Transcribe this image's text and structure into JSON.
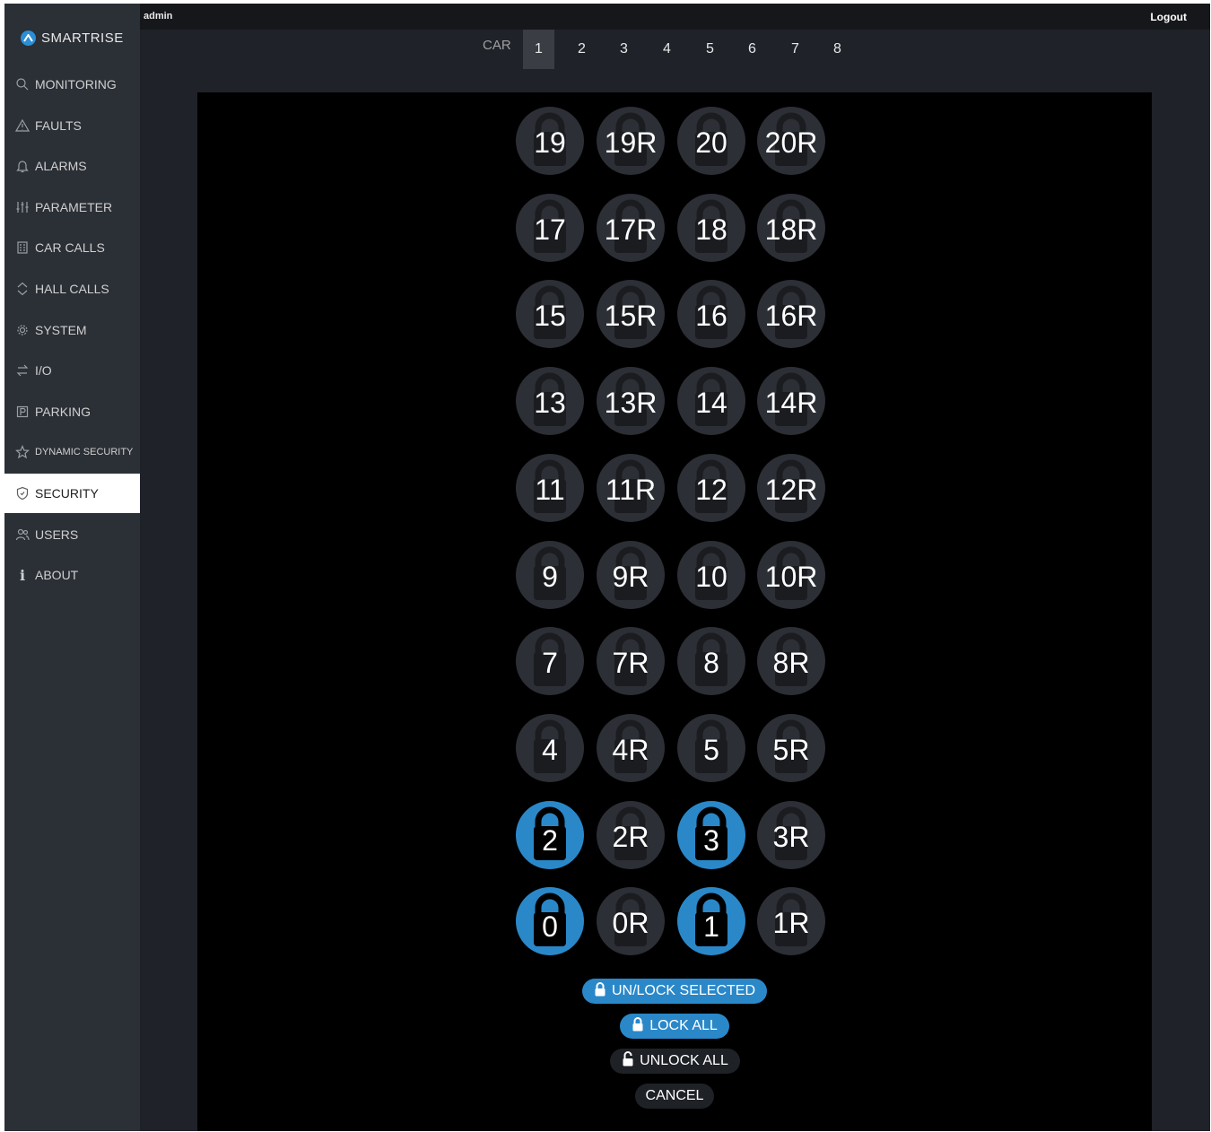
{
  "header": {
    "user": "admin",
    "logout": "Logout"
  },
  "brand": {
    "name": "SMARTRISE"
  },
  "nav": [
    {
      "label": "MONITORING",
      "icon": "search-icon"
    },
    {
      "label": "FAULTS",
      "icon": "warning-icon"
    },
    {
      "label": "ALARMS",
      "icon": "bell-icon"
    },
    {
      "label": "PARAMETER",
      "icon": "sliders-icon"
    },
    {
      "label": "CAR CALLS",
      "icon": "keypad-icon"
    },
    {
      "label": "HALL CALLS",
      "icon": "up-down-icon"
    },
    {
      "label": "SYSTEM",
      "icon": "gear-icon"
    },
    {
      "label": "I/O",
      "icon": "swap-arrows-icon"
    },
    {
      "label": "PARKING",
      "icon": "parking-icon"
    },
    {
      "label": "DYNAMIC SECURITY",
      "icon": "star-icon"
    },
    {
      "label": "SECURITY",
      "icon": "shield-icon",
      "active": true
    },
    {
      "label": "USERS",
      "icon": "users-icon"
    },
    {
      "label": "ABOUT",
      "icon": "info-icon"
    }
  ],
  "car_selector": {
    "label": "CAR",
    "cars": [
      "1",
      "2",
      "3",
      "4",
      "5",
      "6",
      "7",
      "8"
    ],
    "selected": "1"
  },
  "floors": [
    [
      "19",
      "19R",
      "20",
      "20R"
    ],
    [
      "17",
      "17R",
      "18",
      "18R"
    ],
    [
      "15",
      "15R",
      "16",
      "16R"
    ],
    [
      "13",
      "13R",
      "14",
      "14R"
    ],
    [
      "11",
      "11R",
      "12",
      "12R"
    ],
    [
      "9",
      "9R",
      "10",
      "10R"
    ],
    [
      "7",
      "7R",
      "8",
      "8R"
    ],
    [
      "4",
      "4R",
      "5",
      "5R"
    ],
    [
      "2",
      "2R",
      "3",
      "3R"
    ],
    [
      "0",
      "0R",
      "1",
      "1R"
    ]
  ],
  "selected_floors": [
    "2",
    "3",
    "0",
    "1"
  ],
  "actions": {
    "unlock_selected": "UN/LOCK SELECTED",
    "lock_all": "LOCK ALL",
    "unlock_all": "UNLOCK ALL",
    "cancel": "CANCEL"
  },
  "colors": {
    "accent": "#2a88c9",
    "button_idle": "#2c2f35",
    "panel_bg": "#000000",
    "sidebar_bg": "#2b2f36",
    "active_nav_bg": "#ffffff"
  }
}
